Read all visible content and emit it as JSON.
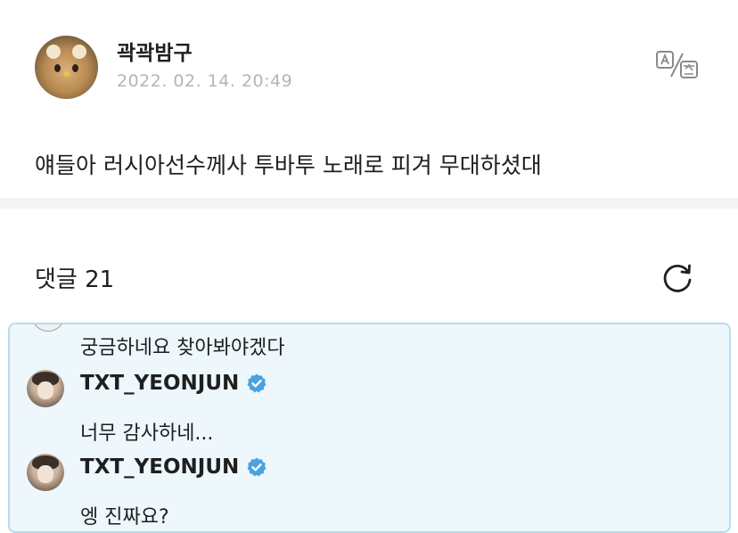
{
  "post": {
    "author": "곽곽밤구",
    "date": "2022. 02. 14. 20:49",
    "content": "얘들아 러시아선수께사 투바투 노래로 피겨 무대하셨대"
  },
  "comments": {
    "header": "댓글 21",
    "items": [
      {
        "text": "궁금하네요 찾아봐야겠다"
      },
      {
        "username": "TXT_YEONJUN",
        "verified": true,
        "text": "너무 감사하네..."
      },
      {
        "username": "TXT_YEONJUN",
        "verified": true,
        "text": "엥 진짜요?"
      }
    ]
  },
  "icons": {
    "translate": "translate-icon",
    "refresh": "refresh-icon",
    "verified": "verified-badge-icon"
  },
  "colors": {
    "highlight_bg": "#edf7fc",
    "highlight_border": "#b9dcec",
    "verified_blue": "#4aa3df",
    "date_gray": "#b5b5b5"
  }
}
